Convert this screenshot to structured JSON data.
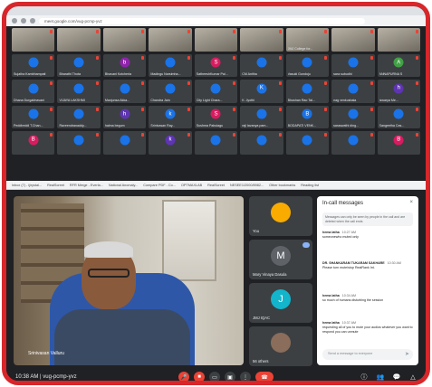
{
  "browser": {
    "url": "meet.google.com/vug-pcmp-yvz"
  },
  "grid_tiles": [
    {
      "name": "",
      "letter": "",
      "color": "#5f6368",
      "photo": true
    },
    {
      "name": "",
      "letter": "",
      "color": "#5f6368",
      "photo": true
    },
    {
      "name": "",
      "letter": "",
      "color": "#5f6368",
      "photo": true
    },
    {
      "name": "",
      "letter": "",
      "color": "#5f6368",
      "photo": true
    },
    {
      "name": "",
      "letter": "",
      "color": "#5f6368",
      "photo": true
    },
    {
      "name": "",
      "letter": "",
      "color": "#5f6368",
      "photo": true
    },
    {
      "name": "JMJ College for...",
      "letter": "",
      "color": "#5f6368",
      "photo": true
    },
    {
      "name": "",
      "letter": "",
      "color": "#5f6368",
      "photo": true
    },
    {
      "name": "",
      "letter": "",
      "color": "#5f6368",
      "photo": true
    },
    {
      "name": "Sujatha Kambhampati",
      "letter": "",
      "color": "#1a73e8",
      "photo": false
    },
    {
      "name": "Bharathi Thota",
      "letter": "",
      "color": "#1a73e8",
      "photo": false
    },
    {
      "name": "Bhavani Kotcherla",
      "letter": "b",
      "color": "#8e24aa",
      "photo": false
    },
    {
      "name": "Madingu Narsimha...",
      "letter": "",
      "color": "#1a73e8",
      "photo": false
    },
    {
      "name": "SatheeshKumar Pal...",
      "letter": "S",
      "color": "#d81b60",
      "photo": false
    },
    {
      "name": "CM Anitha",
      "letter": "",
      "color": "#1a73e8",
      "photo": false
    },
    {
      "name": "Vasuki Gundoju",
      "letter": "",
      "color": "#1a73e8",
      "photo": false
    },
    {
      "name": "sara subudhi",
      "letter": "",
      "color": "#1a73e8",
      "photo": false
    },
    {
      "name": "ANNAPURNA S",
      "letter": "A",
      "color": "#43a047",
      "photo": false
    },
    {
      "name": "Dhana Durgabhavani",
      "letter": "",
      "color": "#1a73e8",
      "photo": false
    },
    {
      "name": "VIJAYA LAKSHMI",
      "letter": "",
      "color": "#1a73e8",
      "photo": false
    },
    {
      "name": "Manjunsa Akka...",
      "letter": "",
      "color": "#1a73e8",
      "photo": false
    },
    {
      "name": "Chandra Jain",
      "letter": "",
      "color": "#1a73e8",
      "photo": false
    },
    {
      "name": "City Light Chara...",
      "letter": "",
      "color": "#1a73e8",
      "photo": false
    },
    {
      "name": "K. Jyothi",
      "letter": "K",
      "color": "#1a73e8",
      "photo": false
    },
    {
      "name": "Bhushan Rao Tal...",
      "letter": "",
      "color": "#1a73e8",
      "photo": false
    },
    {
      "name": "nag venkushala",
      "letter": "",
      "color": "#1a73e8",
      "photo": false
    },
    {
      "name": "Iswarya Me...",
      "letter": "h",
      "color": "#5e35b1",
      "photo": false
    },
    {
      "name": "Peddireddi T.Chan...",
      "letter": "",
      "color": "#1a73e8",
      "photo": false
    },
    {
      "name": "Raveendranaddy...",
      "letter": "",
      "color": "#1a73e8",
      "photo": false
    },
    {
      "name": "halma begum",
      "letter": "h",
      "color": "#5e35b1",
      "photo": false
    },
    {
      "name": "Srinivasan Ray...",
      "letter": "k",
      "color": "#1a73e8",
      "photo": false
    },
    {
      "name": "Sushma Pabulagu",
      "letter": "S",
      "color": "#d81b60",
      "photo": false
    },
    {
      "name": "raji lavanya pam...",
      "letter": "",
      "color": "#1a73e8",
      "photo": false
    },
    {
      "name": "BODAPATI VENK...",
      "letter": "B",
      "color": "#1a73e8",
      "photo": false
    },
    {
      "name": "saraswathi ding...",
      "letter": "",
      "color": "#1a73e8",
      "photo": false
    },
    {
      "name": "Sangeetha Cas...",
      "letter": "",
      "color": "#1a73e8",
      "photo": false
    },
    {
      "name": "",
      "letter": "B",
      "color": "#d81b60",
      "photo": false
    },
    {
      "name": "",
      "letter": "",
      "color": "#1a73e8",
      "photo": false
    },
    {
      "name": "",
      "letter": "",
      "color": "#1a73e8",
      "photo": false
    },
    {
      "name": "",
      "letter": "k",
      "color": "#5e35b1",
      "photo": false
    },
    {
      "name": "",
      "letter": "",
      "color": "#1a73e8",
      "photo": false
    },
    {
      "name": "",
      "letter": "",
      "color": "#1a73e8",
      "photo": false
    },
    {
      "name": "",
      "letter": "",
      "color": "#1a73e8",
      "photo": false
    },
    {
      "name": "",
      "letter": "",
      "color": "#1a73e8",
      "photo": false
    },
    {
      "name": "",
      "letter": "B",
      "color": "#d81b60",
      "photo": false
    }
  ],
  "bookmarks": [
    "Inbox (7) - ijirystal...",
    "RealScreet",
    "RFR Merge - Everla...",
    "National Anomaly...",
    "Compare PDF - Co...",
    "OPTMAXLAB",
    "RealScreet",
    "NESEE1/2000/8982...",
    "Other bookmarks",
    "Reading list"
  ],
  "main_video": {
    "name": "Srinivasan Valluru"
  },
  "side_tiles": [
    {
      "label": "You",
      "letter": "",
      "color": "#f9ab00"
    },
    {
      "label": "Mary Vinaya Dasula",
      "letter": "M",
      "color": "#5f6368"
    },
    {
      "label": "JMJ IQAC",
      "letter": "J",
      "color": "#12b5cb"
    },
    {
      "label": "56 others",
      "letter": "",
      "color": "#8a6d5a"
    }
  ],
  "chat": {
    "title": "In-call messages",
    "close_glyph": "×",
    "note": "Messages can only be seen by people in the call and are deleted when the call ends",
    "messages": [
      {
        "sender": "hema latha",
        "time": "10:27 AM",
        "text": "someonewho muted only"
      },
      {
        "sender": "DR. SHANKARAM TUKARAM SAKHARE",
        "time": "10:30 AM",
        "text": "Please turn mute/stop RealRank Int."
      },
      {
        "sender": "hema latha",
        "time": "10:34 AM",
        "text": "so much of humans disturbing the session"
      },
      {
        "sender": "hema latha",
        "time": "10:37 AM",
        "text": "requesting all of you to mute your audios whatever you want to respond you can unmute"
      }
    ],
    "input_placeholder": "Send a message to everyone",
    "send_glyph": "➤"
  },
  "toolbar": {
    "time": "10:38 AM",
    "separator": "|",
    "code": "vug-pcmp-yvz",
    "mic_glyph": "🎤",
    "cam_glyph": "■",
    "cc_glyph": "▭",
    "present_glyph": "▣",
    "more_glyph": "⋮",
    "end_glyph": "☎",
    "info_glyph": "ⓘ",
    "people_glyph": "👥",
    "chat_glyph": "💬",
    "activities_glyph": "△"
  }
}
